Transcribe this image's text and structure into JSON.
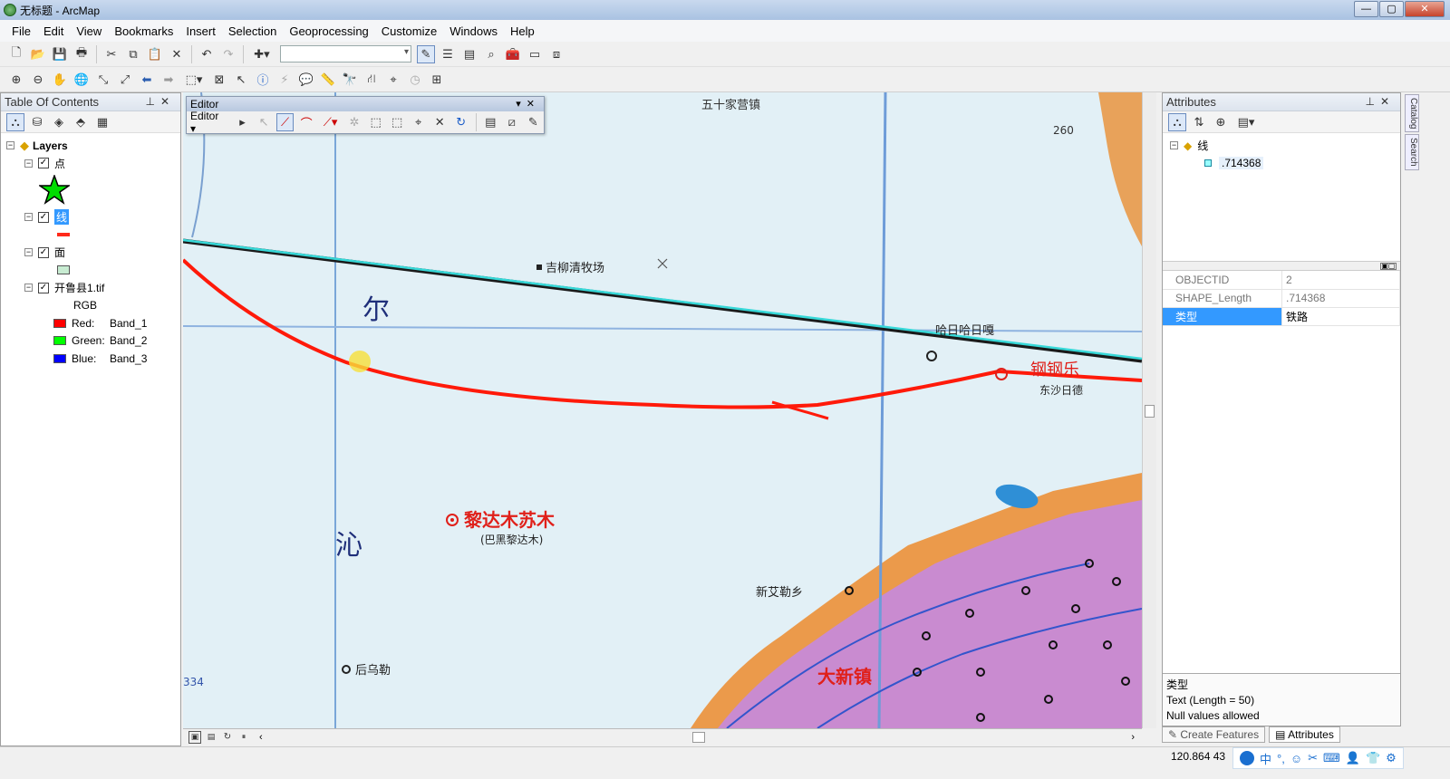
{
  "window": {
    "title": "无标题 - ArcMap",
    "minimize": "—",
    "maximize": "▢",
    "close": "✕"
  },
  "menu": [
    "File",
    "Edit",
    "View",
    "Bookmarks",
    "Insert",
    "Selection",
    "Geoprocessing",
    "Customize",
    "Windows",
    "Help"
  ],
  "toc": {
    "title": "Table Of Contents",
    "root": "Layers",
    "layers": [
      {
        "name": "点",
        "checked": true,
        "selected": false
      },
      {
        "name": "线",
        "checked": true,
        "selected": true
      },
      {
        "name": "面",
        "checked": true,
        "selected": false
      },
      {
        "name": "开鲁县1.tif",
        "checked": true,
        "selected": false
      }
    ],
    "raster_label": "RGB",
    "bands": [
      {
        "label": "Red:",
        "band": "Band_1",
        "color": "#ff0000"
      },
      {
        "label": "Green:",
        "band": "Band_2",
        "color": "#00ff00"
      },
      {
        "label": "Blue:",
        "band": "Band_3",
        "color": "#0000ff"
      }
    ],
    "colors": {
      "point_symbol": "#00dd00",
      "line_symbol": "#ff2a1a",
      "polygon_symbol": "#c8ecd2"
    }
  },
  "editor": {
    "title": "Editor",
    "menu_label": "Editor ▾"
  },
  "map": {
    "labels": [
      {
        "text": "五十家营镇"
      },
      {
        "text": "260"
      },
      {
        "text": "吉柳清牧场"
      },
      {
        "text": "尔"
      },
      {
        "text": "哈日哈日嘎"
      },
      {
        "text": "钢钢乐"
      },
      {
        "text": "东沙日德"
      },
      {
        "text": "黎达木苏木"
      },
      {
        "text": "(巴黑黎达木)"
      },
      {
        "text": "沁"
      },
      {
        "text": "后乌勒"
      },
      {
        "text": "新艾勒乡"
      },
      {
        "text": "334"
      },
      {
        "text": "大新镇"
      }
    ]
  },
  "attributes": {
    "title": "Attributes",
    "tree_layer": "线",
    "tree_feature": ".714368",
    "rows": [
      {
        "field": "OBJECTID",
        "value": "2",
        "selected": false
      },
      {
        "field": "SHAPE_Length",
        "value": ".714368",
        "selected": false
      },
      {
        "field": "类型",
        "value": "铁路",
        "selected": true
      }
    ],
    "desc_title": "类型",
    "desc_line1": "Text (Length = 50)",
    "desc_line2": "Null values allowed",
    "tabs": [
      "Create Features",
      "Attributes"
    ]
  },
  "side_tabs": [
    "Catalog",
    "Search"
  ],
  "status": {
    "coords": "120.864  43"
  },
  "ime": [
    "中",
    "°,",
    "☺",
    "✂",
    "⌨",
    "👤",
    "👕",
    "⚙"
  ]
}
